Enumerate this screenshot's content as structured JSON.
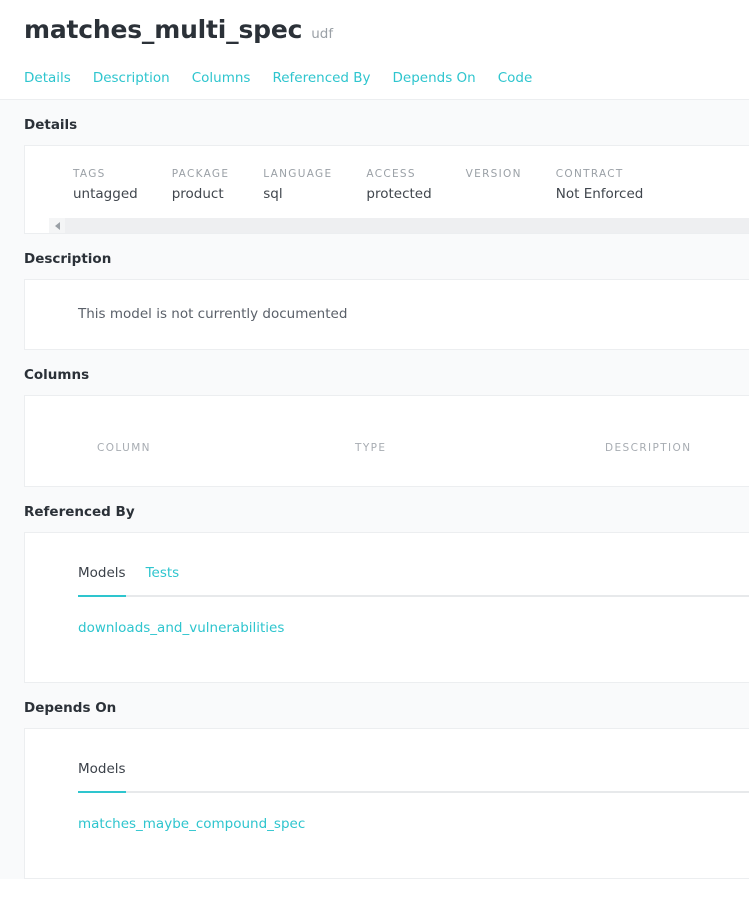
{
  "header": {
    "title": "matches_multi_spec",
    "badge": "udf"
  },
  "nav": {
    "links": [
      {
        "label": "Details"
      },
      {
        "label": "Description"
      },
      {
        "label": "Columns"
      },
      {
        "label": "Referenced By"
      },
      {
        "label": "Depends On"
      },
      {
        "label": "Code"
      }
    ]
  },
  "details": {
    "section_title": "Details",
    "fields": [
      {
        "label": "TAGS",
        "value": "untagged"
      },
      {
        "label": "PACKAGE",
        "value": "product"
      },
      {
        "label": "LANGUAGE",
        "value": "sql"
      },
      {
        "label": "ACCESS",
        "value": "protected"
      },
      {
        "label": "VERSION",
        "value": ""
      },
      {
        "label": "CONTRACT",
        "value": "Not Enforced"
      }
    ]
  },
  "description": {
    "section_title": "Description",
    "text": "This model is not currently documented"
  },
  "columns": {
    "section_title": "Columns",
    "headers": [
      "COLUMN",
      "TYPE",
      "DESCRIPTION"
    ],
    "rows": []
  },
  "referenced_by": {
    "section_title": "Referenced By",
    "tabs": [
      {
        "label": "Models",
        "active": true
      },
      {
        "label": "Tests",
        "active": false
      }
    ],
    "items": [
      {
        "label": "downloads_and_vulnerabilities"
      }
    ]
  },
  "depends_on": {
    "section_title": "Depends On",
    "tabs": [
      {
        "label": "Models",
        "active": true
      }
    ],
    "items": [
      {
        "label": "matches_maybe_compound_spec"
      }
    ]
  },
  "colors": {
    "accent": "#2ec5ce",
    "text": "#2b3138",
    "muted": "#9aa0a6",
    "page_bg": "#f9fafb",
    "card_bg": "#ffffff",
    "border": "#eceef0"
  }
}
